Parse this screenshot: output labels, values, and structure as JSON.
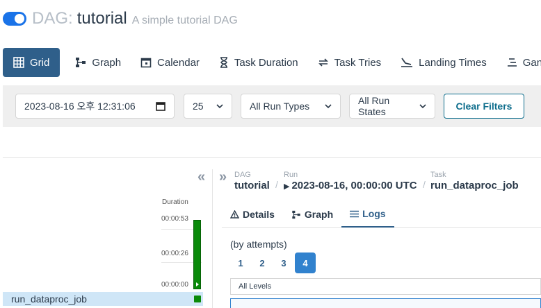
{
  "header": {
    "prefix": "DAG:",
    "dag_id": "tutorial",
    "description": "A simple tutorial DAG"
  },
  "tabs": [
    {
      "label": "Grid",
      "icon": "grid-icon",
      "active": true
    },
    {
      "label": "Graph",
      "icon": "graph-icon"
    },
    {
      "label": "Calendar",
      "icon": "calendar-icon"
    },
    {
      "label": "Task Duration",
      "icon": "hourglass-icon"
    },
    {
      "label": "Task Tries",
      "icon": "retry-icon"
    },
    {
      "label": "Landing Times",
      "icon": "landing-icon"
    },
    {
      "label": "Gantt",
      "icon": "gantt-icon"
    }
  ],
  "filters": {
    "datetime_value": "2023-08-16 오후 12:31:06",
    "num_runs": "25",
    "run_type": "All Run Types",
    "run_state": "All Run States",
    "clear_label": "Clear Filters"
  },
  "grid": {
    "collapse_glyph": "«",
    "duration_label": "Duration",
    "ticks": [
      "00:00:53",
      "00:00:26",
      "00:00:00"
    ],
    "task_name": "run_dataproc_job",
    "status_color": "#008000"
  },
  "detail": {
    "expand_glyph": "»",
    "breadcrumb": {
      "dag_label": "DAG",
      "dag_value": "tutorial",
      "run_label": "Run",
      "run_value": "2023-08-16, 00:00:00 UTC",
      "task_label": "Task",
      "task_value": "run_dataproc_job",
      "separator": "/"
    },
    "tabs": [
      {
        "label": "Details",
        "icon": "warning-icon"
      },
      {
        "label": "Graph",
        "icon": "graph-icon"
      },
      {
        "label": "Logs",
        "icon": "list-icon",
        "active": true
      }
    ],
    "attempts_label": "(by attempts)",
    "attempts": [
      "1",
      "2",
      "3",
      "4"
    ],
    "selected_attempt": "4",
    "levels_label": "All Levels"
  },
  "colors": {
    "accent": "#2f5f8a",
    "toggle": "#1a73e8",
    "success": "#008000"
  }
}
